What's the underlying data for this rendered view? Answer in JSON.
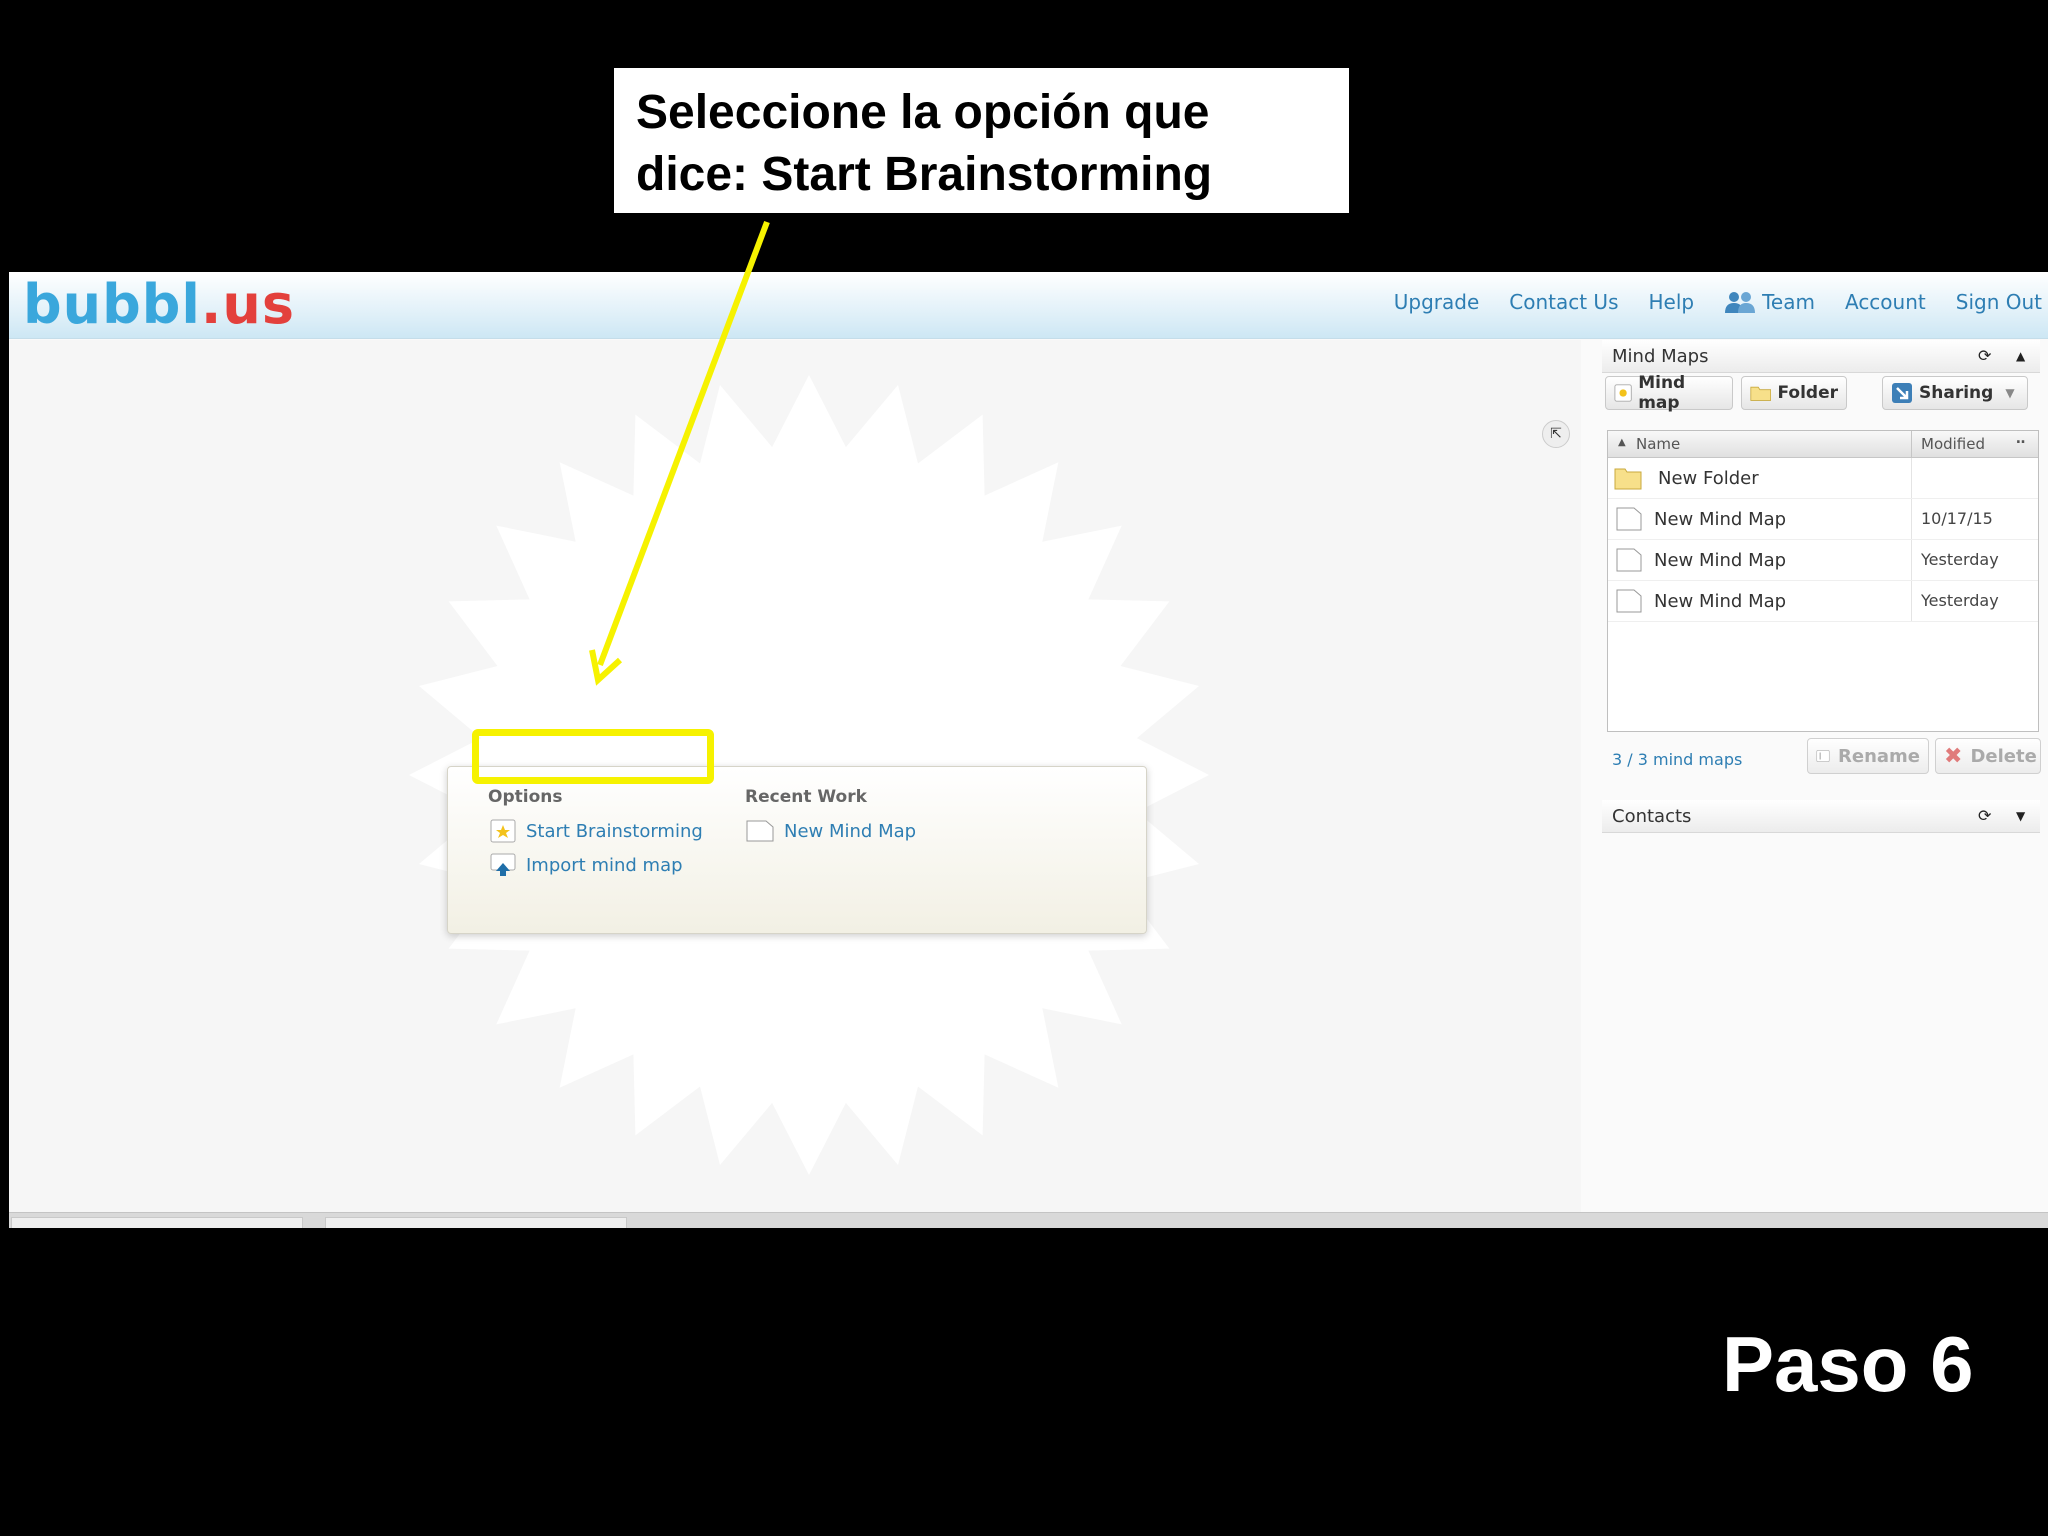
{
  "callout": {
    "line1": "Seleccione la opción que",
    "line2": "dice: Start Brainstorming"
  },
  "step_label": "Paso 6",
  "app": {
    "logo": {
      "part1": "bubbl",
      "part2": ".us"
    },
    "nav": [
      "Upgrade",
      "Contact Us",
      "Help",
      "Team",
      "Account",
      "Sign Out"
    ],
    "dialog": {
      "options_heading": "Options",
      "recent_heading": "Recent Work",
      "start_label": "Start Brainstorming",
      "import_label": "Import mind map",
      "recent_item": "New Mind Map"
    },
    "sidebar": {
      "mindmaps_title": "Mind Maps",
      "toolbar": {
        "mindmap": "Mind map",
        "folder": "Folder",
        "sharing": "Sharing"
      },
      "columns": {
        "name": "Name",
        "modified": "Modified"
      },
      "rows": [
        {
          "name": "New Folder",
          "modified": "",
          "type": "folder"
        },
        {
          "name": "New Mind Map",
          "modified": "10/17/15",
          "type": "file"
        },
        {
          "name": "New Mind Map",
          "modified": "Yesterday",
          "type": "file"
        },
        {
          "name": "New Mind Map",
          "modified": "Yesterday",
          "type": "file"
        }
      ],
      "count": "3 / 3 mind maps",
      "rename": "Rename",
      "delete": "Delete",
      "contacts_title": "Contacts"
    }
  },
  "colors": {
    "highlight": "#f6f200",
    "link": "#2e7eb3",
    "logo_blue": "#3aa7dc",
    "logo_red": "#e3403c"
  }
}
